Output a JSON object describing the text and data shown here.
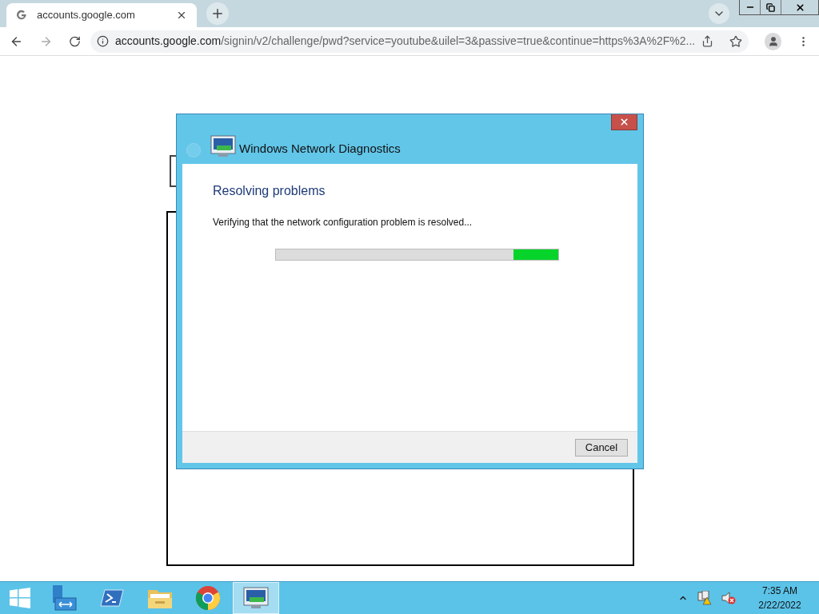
{
  "browser": {
    "tab": {
      "title": "accounts.google.com",
      "selected": true
    },
    "address": {
      "host": "accounts.google.com",
      "path": "/signin/v2/challenge/pwd?service=youtube&uilel=3&passive=true&continue=https%3A%2F%2..."
    }
  },
  "dialog": {
    "title": "Windows Network Diagnostics",
    "heading": "Resolving problems",
    "message": "Verifying that the network configuration problem is resolved...",
    "progress": {
      "level": 0.16
    },
    "buttons": [
      "Cancel"
    ]
  },
  "taskbar": {
    "items": [
      {
        "kind": "server",
        "selected": false
      },
      {
        "kind": "shell",
        "selected": false
      },
      {
        "kind": "folder",
        "selected": false
      },
      {
        "kind": "chrome",
        "selected": false
      },
      {
        "kind": "diagnostics",
        "selected": true
      }
    ],
    "time": "7:35 AM",
    "date": "2/22/2022"
  }
}
